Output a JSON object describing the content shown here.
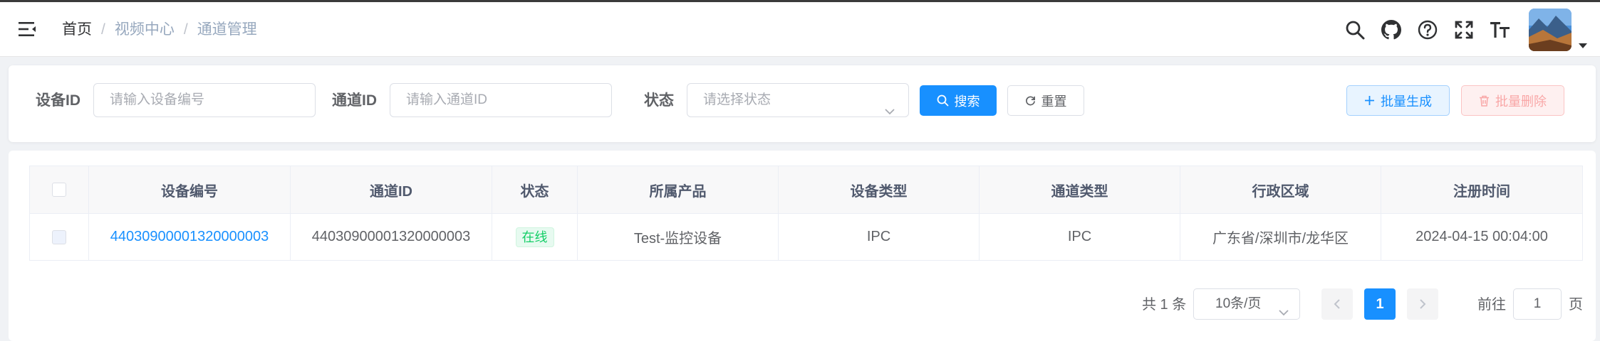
{
  "breadcrumb": {
    "home": "首页",
    "section": "视频中心",
    "current": "通道管理",
    "separator": "/"
  },
  "search": {
    "device_id_label": "设备ID",
    "device_id_placeholder": "请输入设备编号",
    "channel_id_label": "通道ID",
    "channel_id_placeholder": "请输入通道ID",
    "status_label": "状态",
    "status_placeholder": "请选择状态",
    "search_button": "搜索",
    "reset_button": "重置",
    "batch_create_button": "批量生成",
    "batch_delete_button": "批量删除"
  },
  "table": {
    "columns": [
      "设备编号",
      "通道ID",
      "状态",
      "所属产品",
      "设备类型",
      "通道类型",
      "行政区域",
      "注册时间"
    ],
    "rows": [
      {
        "device_no": "44030900001320000003",
        "channel_id": "44030900001320000003",
        "status": "在线",
        "product": "Test-监控设备",
        "device_type": "IPC",
        "channel_type": "IPC",
        "region": "广东省/深圳市/龙华区",
        "registered": "2024-04-15 00:04:00"
      }
    ]
  },
  "pagination": {
    "total": "共 1 条",
    "page_size": "10条/页",
    "current_page": "1",
    "goto_label": "前往",
    "goto_value": "1",
    "page_suffix": "页"
  },
  "colors": {
    "primary": "#1890ff",
    "success": "#13ce66",
    "danger": "#f56c6c"
  },
  "icons": [
    "hamburger-icon",
    "search-icon",
    "github-icon",
    "help-icon",
    "fullscreen-icon",
    "font-size-icon",
    "chevron-down-icon",
    "refresh-icon",
    "plus-icon",
    "trash-icon",
    "chevron-left-icon",
    "chevron-right-icon"
  ]
}
